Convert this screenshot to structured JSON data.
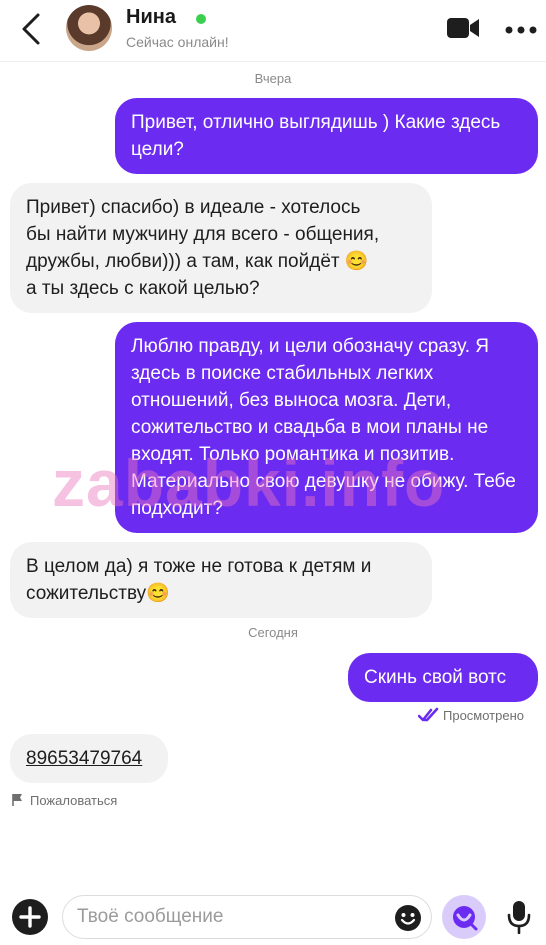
{
  "header": {
    "contact_name": "Нина",
    "status": "Сейчас онлайн!",
    "online_color": "#3ccf4e"
  },
  "chat": {
    "date_yesterday": "Вчера",
    "date_today": "Сегодня",
    "messages": [
      {
        "direction": "out",
        "text": "Привет, отлично выглядишь ) Какие здесь цели?"
      },
      {
        "direction": "in",
        "lines": [
          "Привет) спасибо) в идеале - хотелось",
          "бы найти мужчину для всего - общения,",
          "дружбы, любви))) а там, как пойдёт",
          "а ты здесь с какой целью?"
        ],
        "emoji": "😊"
      },
      {
        "direction": "out",
        "text": "Люблю правду, и цели обозначу сразу. Я здесь в поиске стабильных легких отношений, без выноса мозга. Дети, сожительство и свадьба в мои планы не входят. Только романтика и позитив. Материально свою девушку не обижу. Тебе подходит?"
      },
      {
        "direction": "in",
        "lines": [
          "В целом да) я тоже не готова к детям и",
          "сожительству"
        ],
        "emoji": "😊"
      },
      {
        "direction": "out",
        "text": "Скинь свой вотс"
      },
      {
        "direction": "in",
        "text": "89653479764"
      }
    ],
    "seen_label": "Просмотрено",
    "report_label": "Пожаловаться"
  },
  "watermark": "zababki.info",
  "composer": {
    "placeholder": "Твоё сообщение"
  },
  "colors": {
    "accent": "#6c2bf0",
    "incoming_bubble": "#f2f2f2",
    "smile_button_bg": "#d9ccfb"
  },
  "icons": [
    "back-arrow-icon",
    "video-camera-icon",
    "more-dots-icon",
    "double-check-icon",
    "flag-icon",
    "plus-icon",
    "emoji-icon",
    "smile-face-icon",
    "microphone-icon"
  ]
}
